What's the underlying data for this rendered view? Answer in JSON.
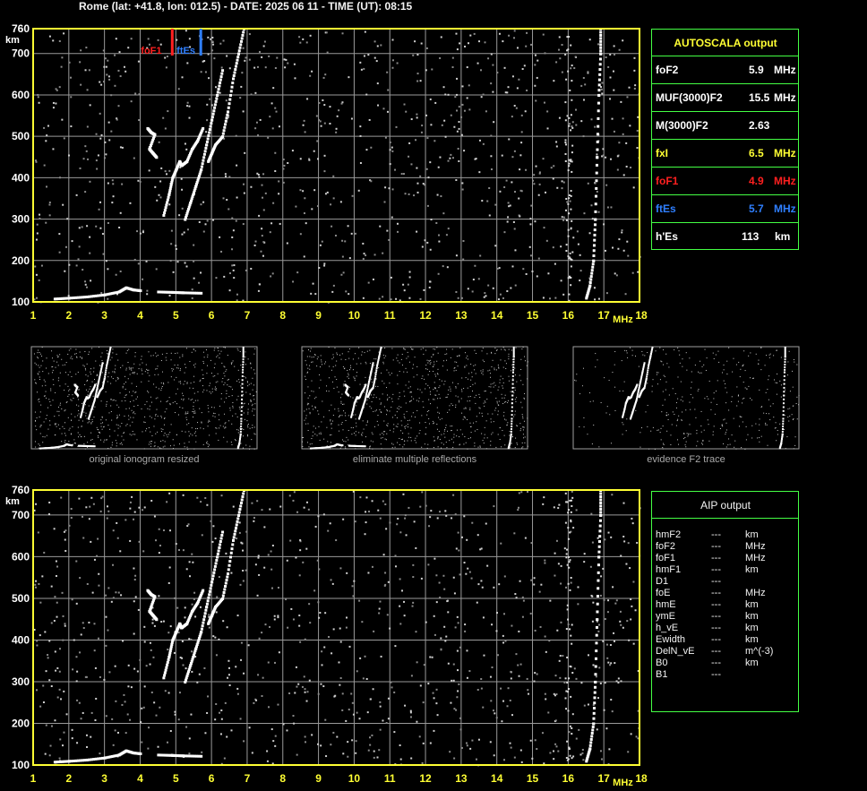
{
  "header": {
    "title": "Rome (lat: +41.8, lon: 012.5) - DATE: 2025 06 11 - TIME (UT): 08:15"
  },
  "colors": {
    "axis": "#ffff33",
    "grid": "#9a9a9a",
    "panel_border": "#44ff44",
    "foF1": "#ff2020",
    "ftEs": "#2f7fff",
    "text_yellow": "#ffff33"
  },
  "autoscala": {
    "title": "AUTOSCALA output",
    "rows": [
      {
        "key": "foF2",
        "value": "5.9",
        "unit": "MHz",
        "color": "#ffffff"
      },
      {
        "key": "MUF(3000)F2",
        "value": "15.5",
        "unit": "MHz",
        "color": "#ffffff"
      },
      {
        "key": "M(3000)F2",
        "value": "2.63",
        "unit": "",
        "color": "#ffffff"
      },
      {
        "key": "fxI",
        "value": "6.5",
        "unit": "MHz",
        "color": "#ffff33"
      },
      {
        "key": "foF1",
        "value": "4.9",
        "unit": "MHz",
        "color": "#ff2020"
      },
      {
        "key": "ftEs",
        "value": "5.7",
        "unit": "MHz",
        "color": "#2f7fff"
      },
      {
        "key": "h'Es",
        "value": "113",
        "unit": "km",
        "color": "#ffffff"
      }
    ]
  },
  "aip": {
    "title": "AIP output",
    "rows": [
      {
        "key": "hmF2",
        "value": "---",
        "unit": "km"
      },
      {
        "key": "foF2",
        "value": "---",
        "unit": "MHz"
      },
      {
        "key": "foF1",
        "value": "---",
        "unit": "MHz"
      },
      {
        "key": "hmF1",
        "value": "---",
        "unit": "km"
      },
      {
        "key": "D1",
        "value": "---",
        "unit": ""
      },
      {
        "key": "foE",
        "value": "---",
        "unit": "MHz"
      },
      {
        "key": "hmE",
        "value": "---",
        "unit": "km"
      },
      {
        "key": "ymE",
        "value": "---",
        "unit": "km"
      },
      {
        "key": "h_vE",
        "value": "---",
        "unit": "km"
      },
      {
        "key": "Ewidth",
        "value": "---",
        "unit": "km"
      },
      {
        "key": "DelN_vE",
        "value": "---",
        "unit": "m^(-3)"
      },
      {
        "key": "B0",
        "value": "---",
        "unit": "km"
      },
      {
        "key": "B1",
        "value": "---",
        "unit": ""
      }
    ]
  },
  "thumbnails": [
    {
      "label": "original ionogram resized"
    },
    {
      "label": "eliminate multiple reflections"
    },
    {
      "label": "evidence F2 trace"
    }
  ],
  "chart_data": [
    {
      "type": "scatter",
      "panel": "top",
      "xlabel": "MHz",
      "ylabel": "km",
      "xlim": [
        1,
        18
      ],
      "ylim": [
        100,
        760
      ],
      "x_ticks": [
        1,
        2,
        3,
        4,
        5,
        6,
        7,
        8,
        9,
        10,
        11,
        12,
        13,
        14,
        15,
        16,
        17,
        18
      ],
      "y_ticks": [
        100,
        200,
        300,
        400,
        500,
        600,
        700,
        760
      ],
      "markers": [
        {
          "name": "foF1",
          "x": 4.9,
          "color": "#ff2020"
        },
        {
          "name": "ftEs",
          "x": 5.7,
          "color": "#2f7fff"
        }
      ],
      "series": [
        {
          "values": [
            [
              1.6,
              108
            ],
            [
              2.0,
              110
            ],
            [
              2.5,
              113
            ],
            [
              3.0,
              118
            ],
            [
              3.4,
              125
            ],
            [
              3.6,
              135
            ],
            [
              3.8,
              130
            ],
            [
              4.0,
              128
            ]
          ]
        },
        {
          "values": [
            [
              4.5,
              125
            ],
            [
              4.9,
              124
            ],
            [
              5.2,
              123
            ],
            [
              5.7,
              122
            ]
          ]
        },
        {
          "values": [
            [
              4.65,
              310
            ],
            [
              4.8,
              360
            ],
            [
              4.9,
              400
            ],
            [
              5.0,
              420
            ],
            [
              5.1,
              440
            ],
            [
              5.15,
              430
            ],
            [
              5.3,
              440
            ],
            [
              5.45,
              470
            ],
            [
              5.6,
              490
            ],
            [
              5.75,
              520
            ]
          ]
        },
        {
          "values": [
            [
              5.9,
              440
            ],
            [
              6.0,
              460
            ],
            [
              6.1,
              480
            ],
            [
              6.3,
              500
            ],
            [
              6.45,
              560
            ],
            [
              6.6,
              640
            ],
            [
              6.75,
              700
            ],
            [
              6.9,
              760
            ]
          ]
        },
        {
          "values": [
            [
              5.25,
              300
            ],
            [
              5.4,
              340
            ],
            [
              5.55,
              380
            ],
            [
              5.7,
              420
            ],
            [
              5.85,
              480
            ],
            [
              6.0,
              540
            ],
            [
              6.15,
              600
            ],
            [
              6.3,
              660
            ]
          ]
        },
        {
          "values": [
            [
              4.2,
              520
            ],
            [
              4.3,
              510
            ],
            [
              4.4,
              505
            ],
            [
              4.25,
              470
            ],
            [
              4.35,
              460
            ],
            [
              4.45,
              450
            ]
          ]
        },
        {
          "values": [
            [
              16.5,
              110
            ],
            [
              16.6,
              140
            ],
            [
              16.7,
              200
            ],
            [
              16.75,
              300
            ],
            [
              16.8,
              450
            ],
            [
              16.85,
              600
            ],
            [
              16.9,
              700
            ],
            [
              16.9,
              760
            ]
          ]
        }
      ]
    },
    {
      "type": "scatter",
      "panel": "bottom",
      "xlabel": "MHz",
      "ylabel": "km",
      "xlim": [
        1,
        18
      ],
      "ylim": [
        100,
        760
      ],
      "x_ticks": [
        1,
        2,
        3,
        4,
        5,
        6,
        7,
        8,
        9,
        10,
        11,
        12,
        13,
        14,
        15,
        16,
        17,
        18
      ],
      "y_ticks": [
        100,
        200,
        300,
        400,
        500,
        600,
        700,
        760
      ],
      "series": [
        {
          "values": [
            [
              1.6,
              108
            ],
            [
              2.0,
              110
            ],
            [
              2.5,
              113
            ],
            [
              3.0,
              118
            ],
            [
              3.4,
              125
            ],
            [
              3.6,
              135
            ],
            [
              3.8,
              130
            ],
            [
              4.0,
              128
            ]
          ]
        },
        {
          "values": [
            [
              4.5,
              125
            ],
            [
              4.9,
              124
            ],
            [
              5.2,
              123
            ],
            [
              5.7,
              122
            ]
          ]
        },
        {
          "values": [
            [
              4.65,
              310
            ],
            [
              4.8,
              360
            ],
            [
              4.9,
              400
            ],
            [
              5.0,
              420
            ],
            [
              5.1,
              440
            ],
            [
              5.15,
              430
            ],
            [
              5.3,
              440
            ],
            [
              5.45,
              470
            ],
            [
              5.6,
              490
            ],
            [
              5.75,
              520
            ]
          ]
        },
        {
          "values": [
            [
              5.9,
              440
            ],
            [
              6.0,
              460
            ],
            [
              6.1,
              480
            ],
            [
              6.3,
              500
            ],
            [
              6.45,
              560
            ],
            [
              6.6,
              640
            ],
            [
              6.75,
              700
            ],
            [
              6.9,
              760
            ]
          ]
        },
        {
          "values": [
            [
              5.25,
              300
            ],
            [
              5.4,
              340
            ],
            [
              5.55,
              380
            ],
            [
              5.7,
              420
            ],
            [
              5.85,
              480
            ],
            [
              6.0,
              540
            ],
            [
              6.15,
              600
            ],
            [
              6.3,
              660
            ]
          ]
        },
        {
          "values": [
            [
              4.2,
              520
            ],
            [
              4.3,
              510
            ],
            [
              4.4,
              505
            ],
            [
              4.25,
              470
            ],
            [
              4.35,
              460
            ],
            [
              4.45,
              450
            ]
          ]
        },
        {
          "values": [
            [
              16.5,
              110
            ],
            [
              16.6,
              140
            ],
            [
              16.7,
              200
            ],
            [
              16.75,
              300
            ],
            [
              16.8,
              450
            ],
            [
              16.85,
              600
            ],
            [
              16.9,
              700
            ],
            [
              16.9,
              760
            ]
          ]
        }
      ]
    }
  ]
}
